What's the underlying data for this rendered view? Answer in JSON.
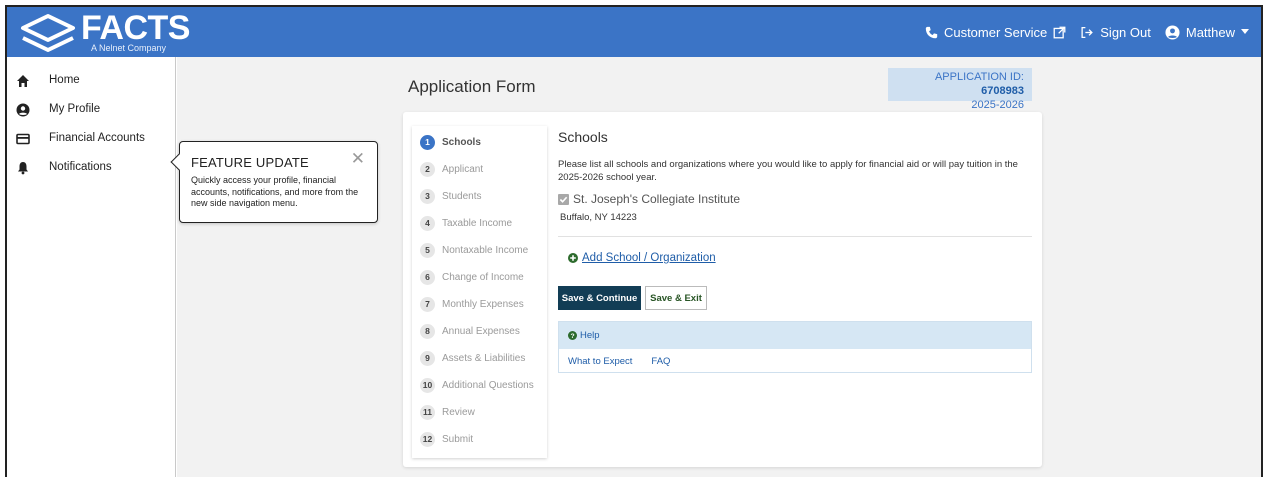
{
  "brand": {
    "name": "FACTS",
    "tagline": "A Nelnet Company"
  },
  "topnav": {
    "customer_service": "Customer Service",
    "sign_out": "Sign Out",
    "user": "Matthew"
  },
  "sidebar": {
    "items": [
      {
        "label": "Home",
        "icon": "home-icon"
      },
      {
        "label": "My Profile",
        "icon": "user-circle-icon"
      },
      {
        "label": "Financial Accounts",
        "icon": "credit-card-icon"
      },
      {
        "label": "Notifications",
        "icon": "bell-icon"
      }
    ]
  },
  "popover": {
    "title": "FEATURE UPDATE",
    "body": "Quickly access your profile, financial accounts, notifications, and more from the new side navigation menu."
  },
  "page": {
    "title": "Application Form",
    "app_id_label": "APPLICATION ID: ",
    "app_id": "6708983",
    "year": "2025-2026"
  },
  "steps": [
    {
      "num": "1",
      "label": "Schools"
    },
    {
      "num": "2",
      "label": "Applicant"
    },
    {
      "num": "3",
      "label": "Students"
    },
    {
      "num": "4",
      "label": "Taxable Income"
    },
    {
      "num": "5",
      "label": "Nontaxable Income"
    },
    {
      "num": "6",
      "label": "Change of Income"
    },
    {
      "num": "7",
      "label": "Monthly Expenses"
    },
    {
      "num": "8",
      "label": "Annual Expenses"
    },
    {
      "num": "9",
      "label": "Assets & Liabilities"
    },
    {
      "num": "10",
      "label": "Additional Questions"
    },
    {
      "num": "11",
      "label": "Review"
    },
    {
      "num": "12",
      "label": "Submit"
    }
  ],
  "section": {
    "title": "Schools",
    "description": "Please list all schools and organizations where you would like to apply for financial aid or will pay tuition in the 2025-2026 school year.",
    "school_name": "St. Joseph's Collegiate Institute",
    "school_address": "Buffalo, NY 14223",
    "add_link": "Add School / Organization",
    "save_continue": "Save & Continue",
    "save_exit": "Save & Exit"
  },
  "help": {
    "title": "Help",
    "links": [
      "What to Expect",
      "FAQ"
    ]
  },
  "colors": {
    "brand_blue": "#3b74c6",
    "dark_button": "#123d55",
    "help_bg": "#d6e7f4"
  }
}
